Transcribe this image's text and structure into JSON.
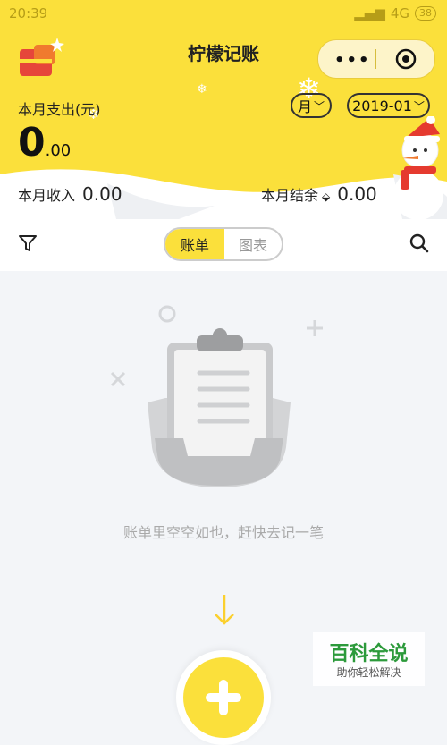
{
  "status_bar": {
    "time": "20:39",
    "network": "4G",
    "battery": "38"
  },
  "header": {
    "title": "柠檬记账"
  },
  "summary": {
    "expense_label": "本月支出(元)",
    "expense_int": "0",
    "expense_dec": ".00",
    "period_unit": "月",
    "period_value": "2019-01",
    "income_label": "本月收入",
    "income_value": "0.00",
    "balance_label": "本月结余",
    "balance_value": "0.00"
  },
  "tabs": {
    "bill": "账单",
    "chart": "图表"
  },
  "empty": {
    "message": "账单里空空如也，赶快去记一笔"
  },
  "watermark": {
    "line1": "百科全说",
    "line2": "助你轻松解决"
  },
  "colors": {
    "accent": "#fbe03b",
    "brand_green": "#2c9a3b"
  },
  "icons": [
    "filter-icon",
    "search-icon",
    "more-icon",
    "target-icon",
    "add-icon",
    "arrow-down-icon"
  ]
}
